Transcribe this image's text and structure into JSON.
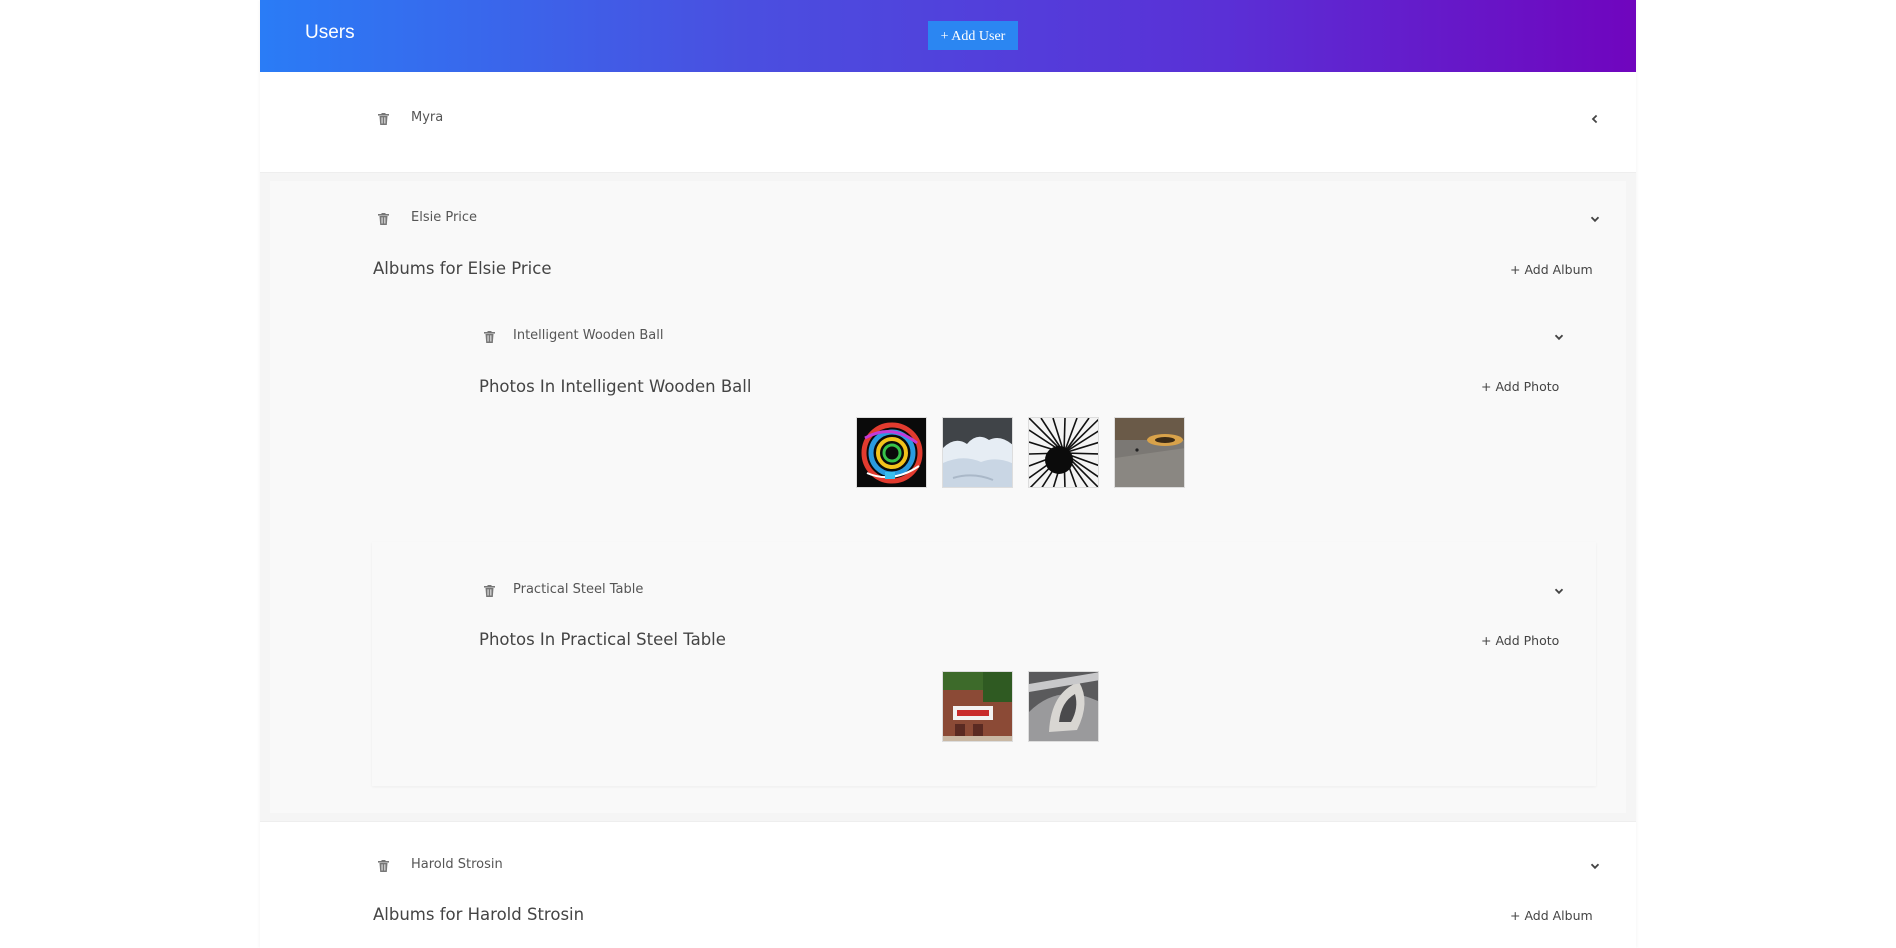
{
  "header": {
    "title": "Users",
    "add_user_label": "+ Add User"
  },
  "users": [
    {
      "name": "Myra",
      "expanded": false
    },
    {
      "name": "Elsie Price",
      "expanded": true,
      "albums_title": "Albums for Elsie Price",
      "add_album_label": "+ Add Album",
      "albums": [
        {
          "name": "Intelligent Wooden Ball",
          "photos_title": "Photos In Intelligent Wooden Ball",
          "add_photo_label": "+ Add Photo",
          "photos": [
            "colorful-abstract-swirl",
            "snow-mound",
            "black-white-radial-burst",
            "manhole-cover-ground"
          ]
        },
        {
          "name": "Practical Steel Table",
          "photos_title": "Photos In Practical Steel Table",
          "add_photo_label": "+ Add Photo",
          "photos": [
            "red-brick-building-sign",
            "curved-concrete-ramp"
          ]
        }
      ]
    },
    {
      "name": "Harold Strosin",
      "expanded": true,
      "albums_title": "Albums for Harold Strosin",
      "add_album_label": "+ Add Album"
    }
  ],
  "colors": {
    "header_start": "#2a7cf6",
    "header_end": "#7005be",
    "button_blue": "#2b86f2"
  }
}
